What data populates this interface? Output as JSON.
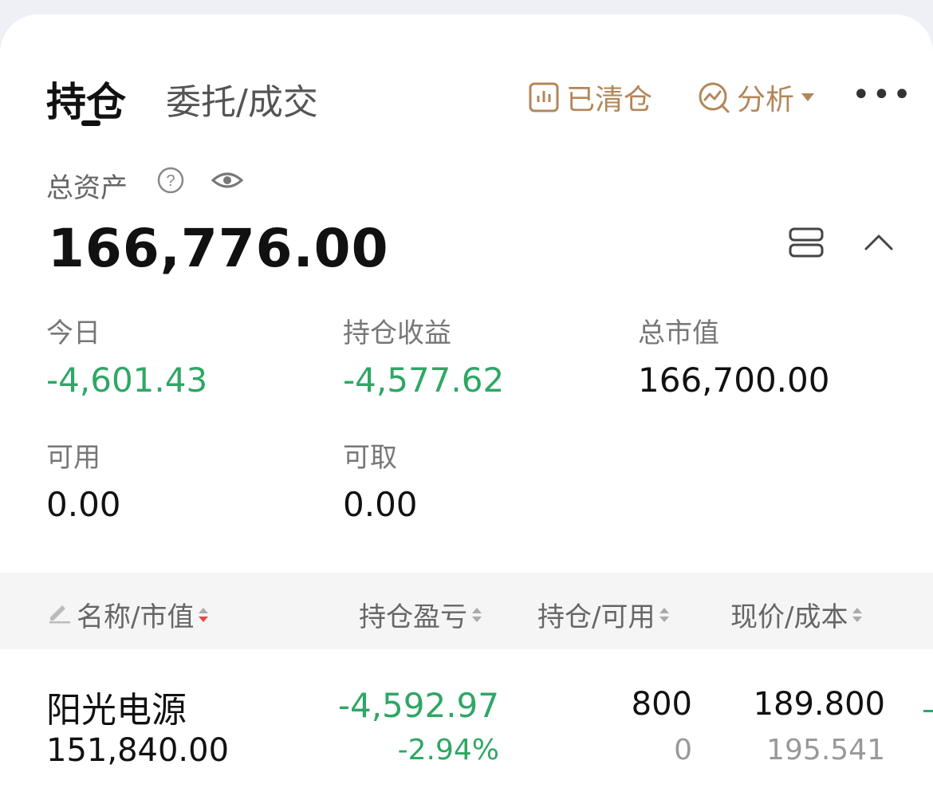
{
  "tabs": {
    "active": "持仓",
    "other": "委托/成交"
  },
  "actions": {
    "cleared": {
      "label": "已清仓",
      "icon": "bar-chart-icon"
    },
    "analysis": {
      "label": "分析",
      "icon": "analysis-icon"
    },
    "more": "•••"
  },
  "colors": {
    "accent": "#b38758",
    "down": "#2fa765",
    "text": "#111111"
  },
  "total": {
    "label": "总资产",
    "value": "166,776.00"
  },
  "metrics": [
    {
      "label": "今日",
      "value": "-4,601.43"
    },
    {
      "label": "持仓收益",
      "value": "-4,577.62"
    },
    {
      "label": "总市值",
      "value": "166,700.00"
    },
    {
      "label": "可用",
      "value": "0.00"
    },
    {
      "label": "可取",
      "value": "0.00"
    }
  ],
  "table": {
    "headers": [
      "名称/市值",
      "持仓盈亏",
      "持仓/可用",
      "现价/成本"
    ],
    "rows": [
      {
        "name": "阳光电源",
        "market_value": "151,840.00",
        "pnl": "-4,592.97",
        "pnl_pct": "-2.94%",
        "position": "800",
        "available": "0",
        "price": "189.800",
        "cost": "195.541"
      }
    ]
  }
}
